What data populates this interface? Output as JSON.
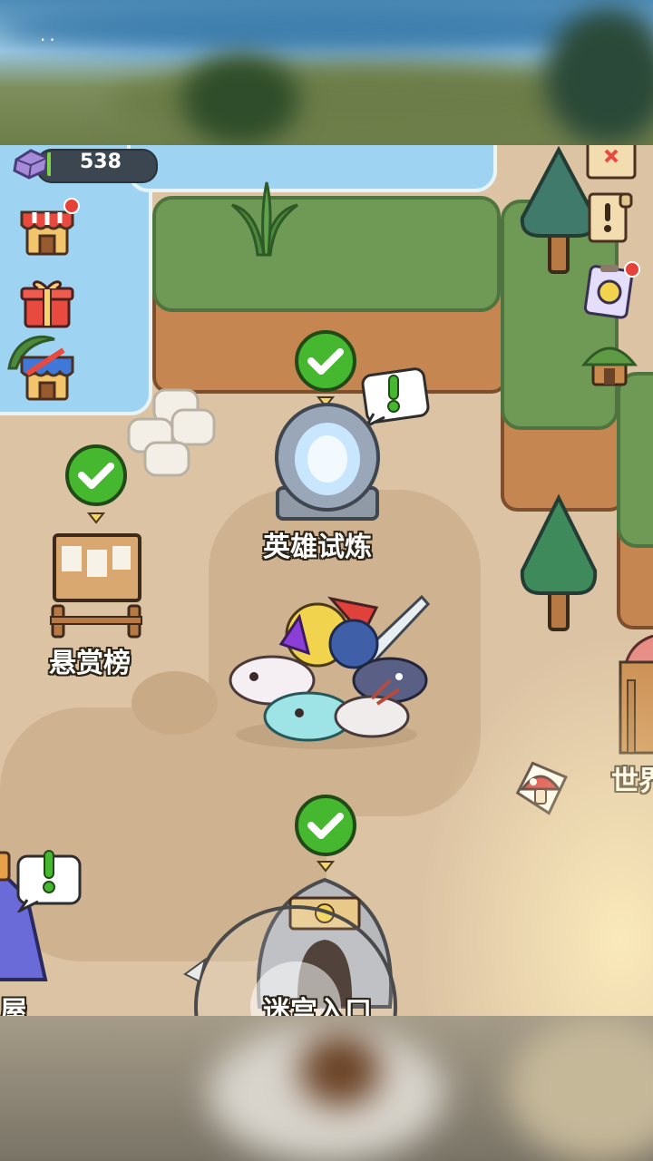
{
  "hud": {
    "gems": "538"
  },
  "status_bar": {
    "dots": ".."
  },
  "buildings": {
    "hero_trial": "英雄试炼",
    "bounty_board": "悬赏榜",
    "maze_entrance": "迷宫入口",
    "world": "世界",
    "house": "屋"
  },
  "icons": {
    "left_side": [
      "shop-icon",
      "gift-icon",
      "special-shop-icon"
    ],
    "right_side": [
      "map-icon",
      "quest-scroll-icon",
      "pet-card-icon",
      "hut-icon"
    ]
  },
  "colors": {
    "check_green": "#45b82f",
    "notify_red": "#e6423a",
    "hud_bg": "#3b4650"
  }
}
